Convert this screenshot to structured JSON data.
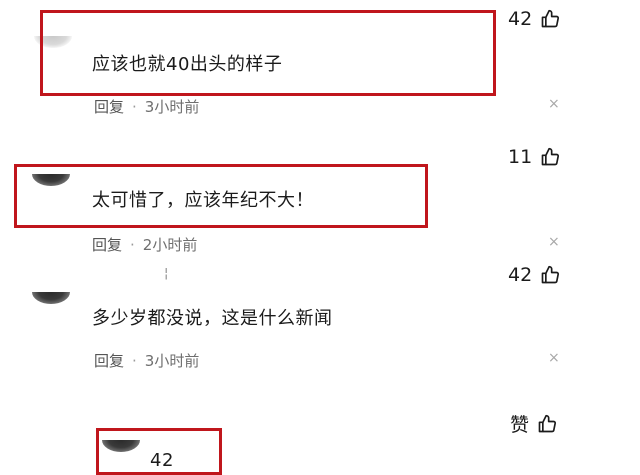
{
  "comments": [
    {
      "text": "应该也就40出头的样子",
      "reply": "回复",
      "time": "3小时前",
      "likes": "42",
      "close": "×"
    },
    {
      "text": "太可惜了，应该年纪不大！",
      "reply": "回复",
      "time": "2小时前",
      "likes": "11",
      "close": "×"
    },
    {
      "text": "多少岁都没说，这是什么新闻",
      "reply": "回复",
      "time": "3小时前",
      "likes": "42",
      "close": "×"
    }
  ],
  "partial_comment": {
    "likes_label": "赞",
    "count": "42"
  },
  "stray_mark": "¦",
  "colors": {
    "highlight": "#c0161c",
    "meta_text": "#6f6f6f",
    "main_text": "#1b1b1b"
  },
  "icons": {
    "like": "thumbs-up-icon",
    "close": "close-icon"
  }
}
